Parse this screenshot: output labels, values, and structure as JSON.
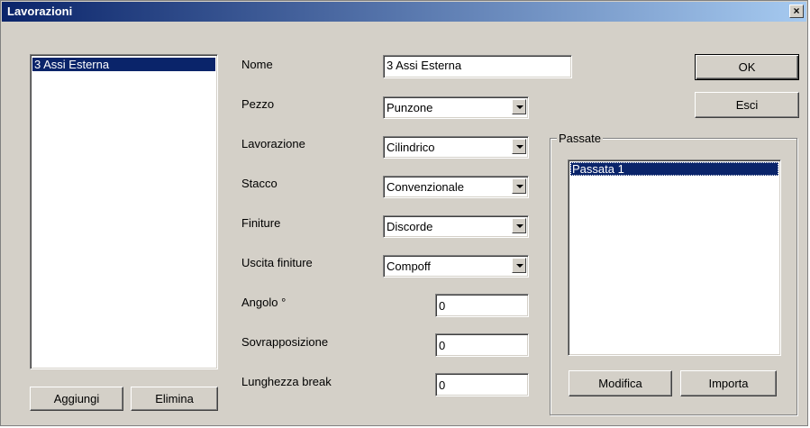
{
  "window": {
    "title": "Lavorazioni",
    "close_label": "×"
  },
  "left_list": {
    "items": [
      "3 Assi Esterna"
    ]
  },
  "buttons": {
    "aggiungi": "Aggiungi",
    "elimina": "Elimina",
    "ok": "OK",
    "esci": "Esci",
    "modifica": "Modifica",
    "importa": "Importa"
  },
  "form": {
    "nome": {
      "label": "Nome",
      "value": "3 Assi Esterna"
    },
    "pezzo": {
      "label": "Pezzo",
      "value": "Punzone"
    },
    "lavorazione": {
      "label": "Lavorazione",
      "value": "Cilindrico"
    },
    "stacco": {
      "label": "Stacco",
      "value": "Convenzionale"
    },
    "finiture": {
      "label": "Finiture",
      "value": "Discorde"
    },
    "uscita_finiture": {
      "label": "Uscita finiture",
      "value": "Compoff"
    },
    "angolo": {
      "label": "Angolo °",
      "value": "0"
    },
    "sovrapposizione": {
      "label": "Sovrapposizione",
      "value": "0"
    },
    "lunghezza_break": {
      "label": "Lunghezza break",
      "value": "0"
    }
  },
  "passate": {
    "group_label": "Passate",
    "items": [
      "Passata 1"
    ]
  },
  "colors": {
    "titlebar_start": "#0a246a",
    "titlebar_end": "#a6caf0",
    "face": "#d4d0c8",
    "selection": "#0a246a"
  }
}
